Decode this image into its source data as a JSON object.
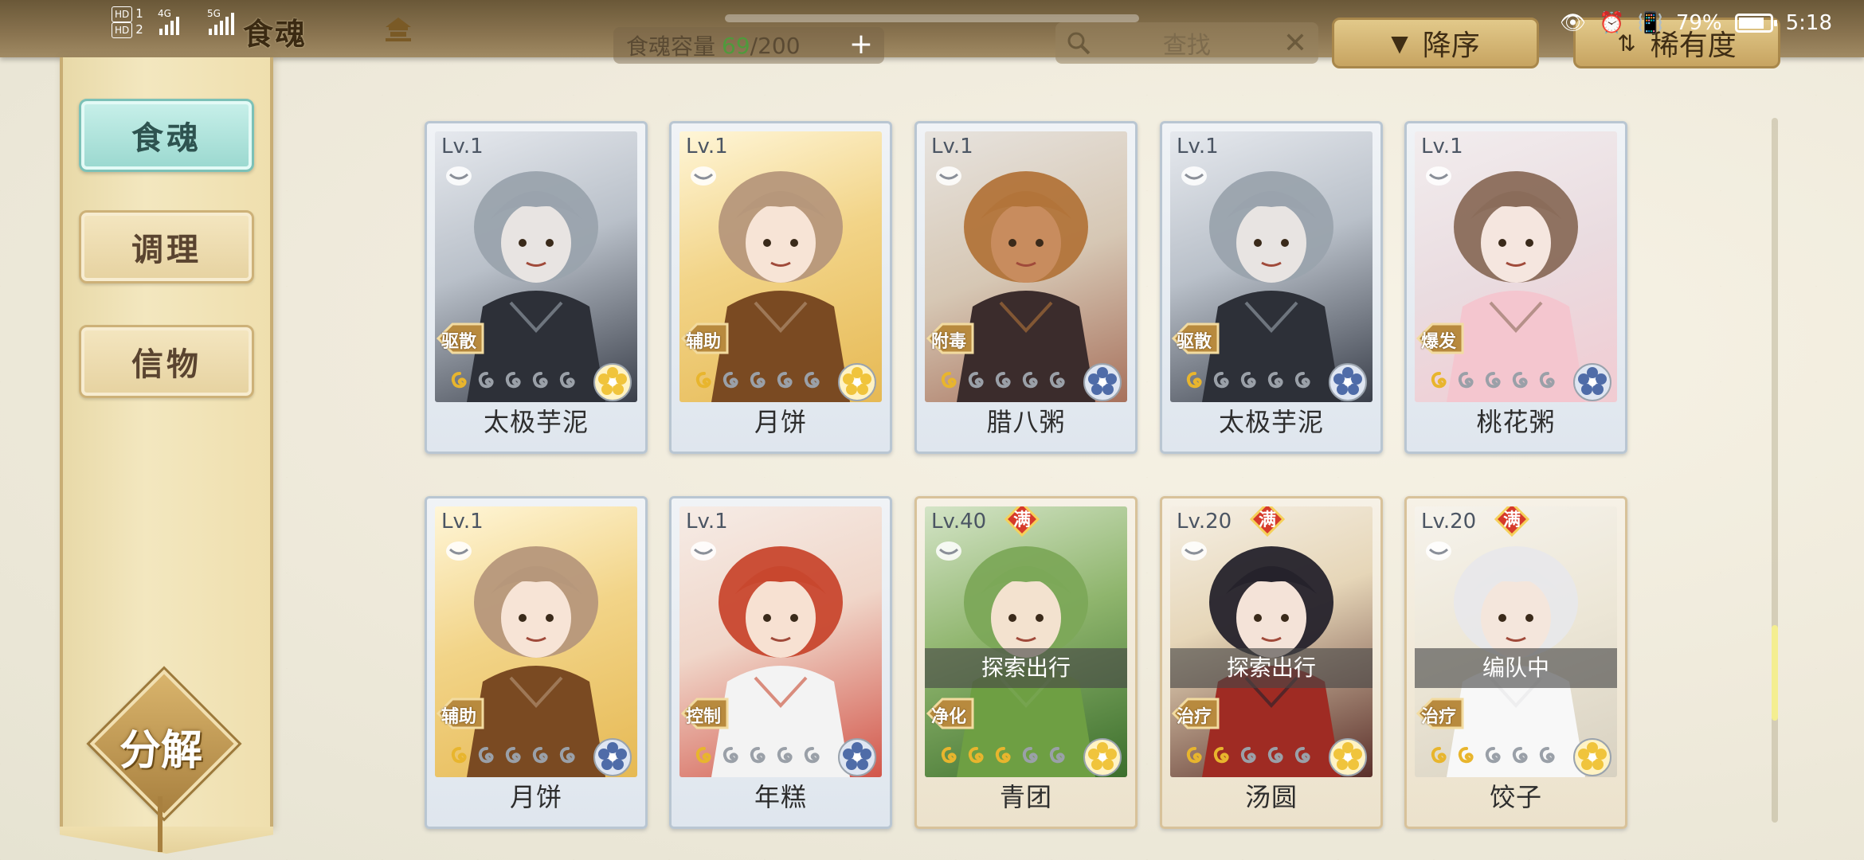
{
  "status_bar": {
    "left": {
      "hd1": "HD",
      "sim1": "1",
      "hd2": "HD",
      "sim2": "2",
      "net1": "4G",
      "net2": "5G"
    },
    "battery_percent": "79%",
    "time": "5:18"
  },
  "header": {
    "title": "食魂",
    "capacity_label": "食魂容量",
    "capacity_current": "69",
    "capacity_max": "/200",
    "search_placeholder": "查找",
    "sort_order": "降序",
    "sort_by": "稀有度"
  },
  "sidebar": {
    "tabs": [
      {
        "label": "食魂",
        "active": true
      },
      {
        "label": "调理",
        "active": false
      },
      {
        "label": "信物",
        "active": false
      }
    ],
    "decompose_label": "分解"
  },
  "cards": [
    {
      "level": "Lv.1",
      "name": "太极芋泥",
      "role": "驱散",
      "maxed": false,
      "status": "",
      "theme": "gray",
      "emblem": "gold",
      "stars": 1
    },
    {
      "level": "Lv.1",
      "name": "月饼",
      "role": "辅助",
      "maxed": false,
      "status": "",
      "theme": "gold",
      "emblem": "gold",
      "stars": 1
    },
    {
      "level": "Lv.1",
      "name": "腊八粥",
      "role": "附毒",
      "maxed": false,
      "status": "",
      "theme": "brown",
      "emblem": "blue",
      "stars": 1
    },
    {
      "level": "Lv.1",
      "name": "太极芋泥",
      "role": "驱散",
      "maxed": false,
      "status": "",
      "theme": "gray",
      "emblem": "blue",
      "stars": 1
    },
    {
      "level": "Lv.1",
      "name": "桃花粥",
      "role": "爆发",
      "maxed": false,
      "status": "",
      "theme": "pink",
      "emblem": "blue",
      "stars": 1
    },
    {
      "level": "Lv.1",
      "name": "月饼",
      "role": "辅助",
      "maxed": false,
      "status": "",
      "theme": "gold",
      "emblem": "blue",
      "stars": 1
    },
    {
      "level": "Lv.1",
      "name": "年糕",
      "role": "控制",
      "maxed": false,
      "status": "",
      "theme": "red",
      "emblem": "blue",
      "stars": 1
    },
    {
      "level": "Lv.40",
      "name": "青团",
      "role": "净化",
      "maxed": true,
      "maxed_label": "满",
      "status": "探索出行",
      "theme": "green",
      "emblem": "gold",
      "stars": 3
    },
    {
      "level": "Lv.20",
      "name": "汤圆",
      "role": "治疗",
      "maxed": true,
      "maxed_label": "满",
      "status": "探索出行",
      "theme": "dark",
      "emblem": "gold",
      "stars": 2
    },
    {
      "level": "Lv.20",
      "name": "饺子",
      "role": "治疗",
      "maxed": true,
      "maxed_label": "满",
      "status": "编队中",
      "theme": "white",
      "emblem": "gold",
      "stars": 2
    }
  ],
  "colors": {
    "accent_teal": "#9ad8cf",
    "gold": "#c7a461",
    "capacity_green": "#4f9a3c"
  }
}
